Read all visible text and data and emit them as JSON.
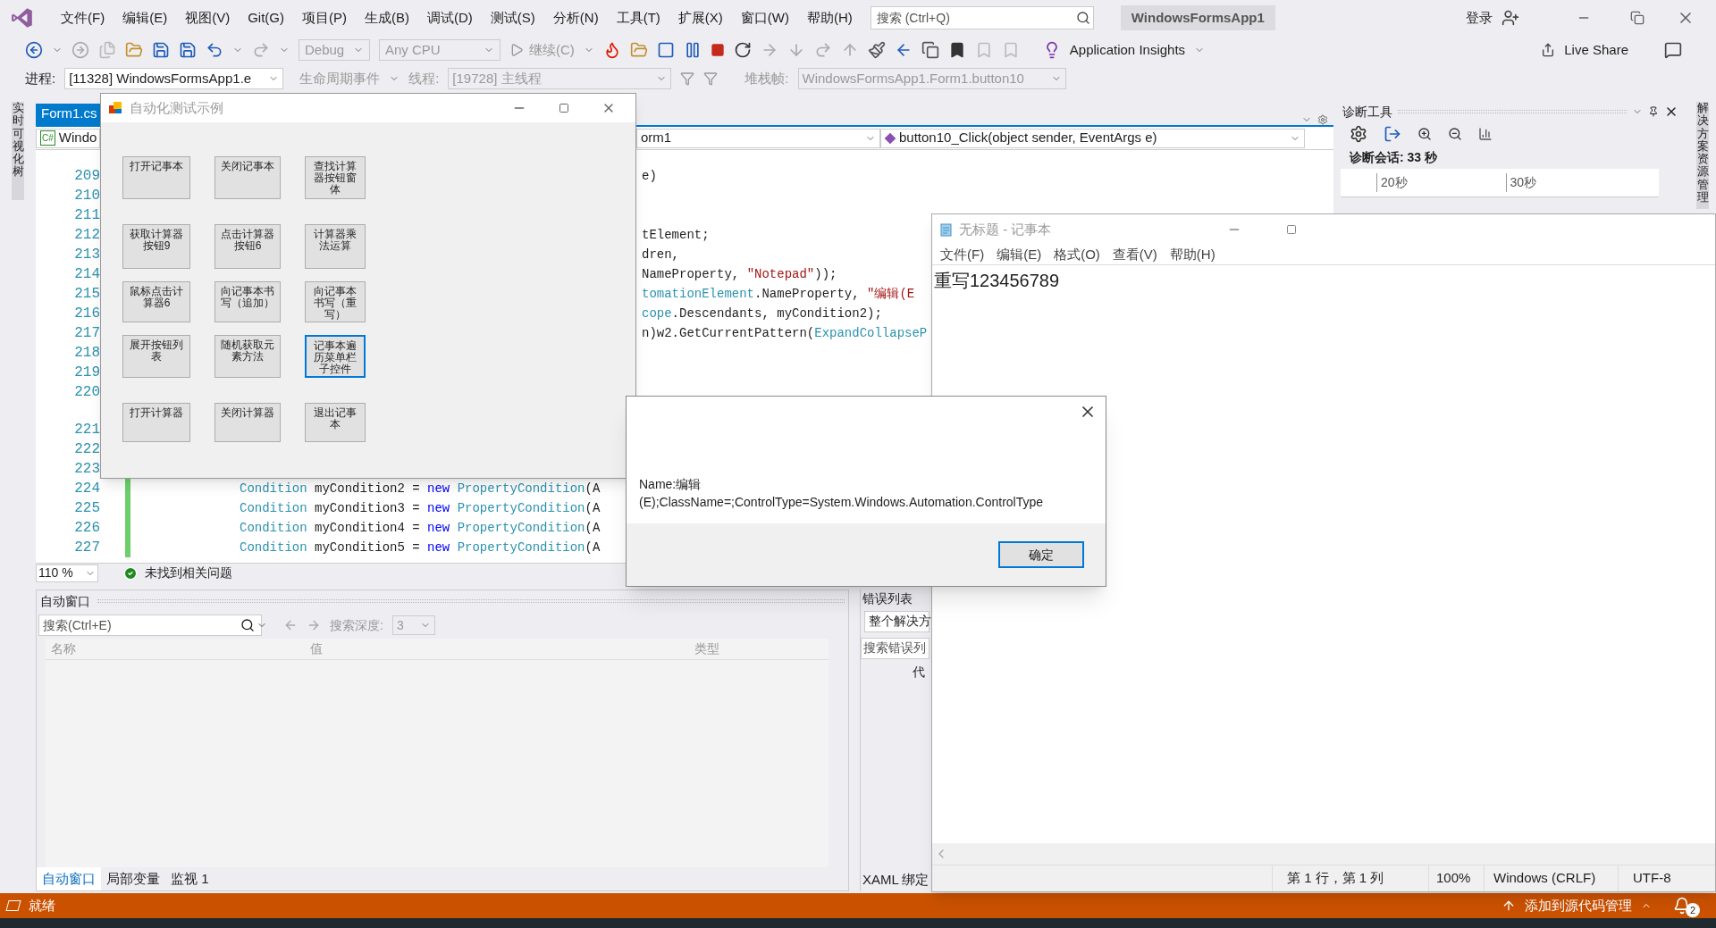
{
  "menu_bar": {
    "items": [
      "文件(F)",
      "编辑(E)",
      "视图(V)",
      "Git(G)",
      "项目(P)",
      "生成(B)",
      "调试(D)",
      "测试(S)",
      "分析(N)",
      "工具(T)",
      "扩展(X)",
      "窗口(W)",
      "帮助(H)"
    ],
    "search": {
      "placeholder": "搜索 (Ctrl+Q)"
    },
    "solution_name": "WindowsFormsApp1",
    "sign_in": "登录"
  },
  "toolbar": {
    "configuration": "Debug",
    "platform": "Any CPU",
    "continue": "继续(C)",
    "insights": "Application Insights",
    "live_share": "Live Share"
  },
  "debug_location": {
    "process_label": "进程:",
    "process": "[11328] WindowsFormsApp1.e",
    "lifecycle": "生命周期事件",
    "thread_label": "线程:",
    "thread": "[19728] 主线程",
    "stack_label": "堆栈帧:",
    "stack_frame": "WindowsFormsApp1.Form1.button10"
  },
  "left_tab": "实时可视化树",
  "right_tab": "解决方案资源管理",
  "editor": {
    "tabs": [
      {
        "label": "Form1.cs",
        "selected": true
      }
    ],
    "language_badge": "C#",
    "nav": [
      "Windo",
      "orm1",
      "button10_Click(object sender, EventArgs e)"
    ],
    "lines": [
      {
        "number": "209",
        "kind": "fragment",
        "tokens": [
          {
            "text": "e)",
            "kind": "plain"
          }
        ]
      },
      {
        "number": "210",
        "kind": "fragment"
      },
      {
        "number": "211",
        "kind": "fragment"
      },
      {
        "number": "212",
        "kind": "fragment",
        "tokens": [
          {
            "text": "tElement;",
            "kind": "plain"
          }
        ]
      },
      {
        "number": "213",
        "kind": "fragment",
        "tokens": [
          {
            "text": "dren,",
            "kind": "plain"
          }
        ]
      },
      {
        "number": "214",
        "kind": "fragment",
        "tokens": [
          {
            "text": "NameProperty, ",
            "kind": "plain"
          },
          {
            "text": "\"Notepad\"",
            "kind": "string"
          },
          {
            "text": "));",
            "kind": "plain"
          }
        ]
      },
      {
        "number": "215",
        "kind": "fragment",
        "tokens": [
          {
            "text": "tomationElement",
            "kind": "type"
          },
          {
            "text": ".NameProperty, ",
            "kind": "plain"
          },
          {
            "text": "\"编辑(E",
            "kind": "string"
          }
        ]
      },
      {
        "number": "216",
        "kind": "fragment",
        "tokens": [
          {
            "text": "cope",
            "kind": "type"
          },
          {
            "text": ".Descendants, myCondition2);",
            "kind": "plain"
          }
        ]
      },
      {
        "number": "217",
        "kind": "fragment",
        "tokens": [
          {
            "text": "n)w2.GetCurrentPattern(",
            "kind": "plain"
          },
          {
            "text": "ExpandCollapseP",
            "kind": "type"
          }
        ]
      },
      {
        "number": "218",
        "kind": "fragment"
      },
      {
        "number": "219",
        "kind": "fragment"
      },
      {
        "number": "220",
        "kind": "fragment"
      },
      {
        "number": "221",
        "kind": "full"
      },
      {
        "number": "222",
        "kind": "full"
      },
      {
        "number": "223",
        "kind": "full"
      },
      {
        "number": "224",
        "kind": "full",
        "tokens": [
          {
            "text": "Condition",
            "kind": "type"
          },
          {
            "text": " myCondition2 = ",
            "kind": "plain"
          },
          {
            "text": "new",
            "kind": "keyword"
          },
          {
            "text": " PropertyCondition",
            "kind": "type"
          },
          {
            "text": "(A",
            "kind": "plain"
          }
        ]
      },
      {
        "number": "225",
        "kind": "full",
        "tokens": [
          {
            "text": "Condition",
            "kind": "type"
          },
          {
            "text": " myCondition3 = ",
            "kind": "plain"
          },
          {
            "text": "new",
            "kind": "keyword"
          },
          {
            "text": " PropertyCondition",
            "kind": "type"
          },
          {
            "text": "(A",
            "kind": "plain"
          }
        ]
      },
      {
        "number": "226",
        "kind": "full",
        "tokens": [
          {
            "text": "Condition",
            "kind": "type"
          },
          {
            "text": " myCondition4 = ",
            "kind": "plain"
          },
          {
            "text": "new",
            "kind": "keyword"
          },
          {
            "text": " PropertyCondition",
            "kind": "type"
          },
          {
            "text": "(A",
            "kind": "plain"
          }
        ]
      },
      {
        "number": "227",
        "kind": "full",
        "tokens": [
          {
            "text": "Condition",
            "kind": "type"
          },
          {
            "text": " myCondition5 = ",
            "kind": "plain"
          },
          {
            "text": "new",
            "kind": "keyword"
          },
          {
            "text": " PropertyCondition",
            "kind": "type"
          },
          {
            "text": "(A",
            "kind": "plain"
          }
        ]
      }
    ],
    "zoom": "110 %",
    "issues": "未找到相关问题"
  },
  "diagnostics": {
    "title": "诊断工具",
    "session": "诊断会话: 33 秒",
    "ticks": [
      "20秒",
      "30秒"
    ]
  },
  "autos": {
    "title": "自动窗口",
    "search": {
      "placeholder": "搜索(Ctrl+E)"
    },
    "depth_label": "搜索深度:",
    "depth": "3",
    "columns": [
      "名称",
      "值",
      "类型"
    ],
    "tabs": [
      {
        "label": "自动窗口",
        "selected": true
      },
      {
        "label": "局部变量",
        "selected": false
      },
      {
        "label": "监视 1",
        "selected": false
      }
    ]
  },
  "error_list": {
    "title": "错误列表",
    "scope": "整个解决方",
    "search": {
      "placeholder": "搜索错误列"
    },
    "column": "代",
    "tab": "XAML 绑定"
  },
  "form_window": {
    "title": "自动化测试示例",
    "buttons": [
      {
        "label": "打开记事本",
        "focused": false
      },
      {
        "label": "关闭记事本",
        "focused": false
      },
      {
        "label": "查找计算器按钮窗体",
        "focused": false
      },
      {
        "label": "获取计算器按钮9",
        "focused": false
      },
      {
        "label": "点击计算器按钮6",
        "focused": false
      },
      {
        "label": "计算器乘法运算",
        "focused": false
      },
      {
        "label": "鼠标点击计算器6",
        "focused": false
      },
      {
        "label": "向记事本书写（追加）",
        "focused": false
      },
      {
        "label": "向记事本书写（重写）",
        "focused": false
      },
      {
        "label": "展开按钮列表",
        "focused": false
      },
      {
        "label": "随机获取元素方法",
        "focused": false
      },
      {
        "label": "记事本遍历菜单栏子控件",
        "focused": true
      },
      {
        "label": "打开计算器",
        "focused": false
      },
      {
        "label": "关闭计算器",
        "focused": false
      },
      {
        "label": "退出记事本",
        "focused": false
      }
    ]
  },
  "notepad": {
    "title": "无标题 - 记事本",
    "menu": [
      "文件(F)",
      "编辑(E)",
      "格式(O)",
      "查看(V)",
      "帮助(H)"
    ],
    "text": "重写123456789",
    "status": [
      "第 1 行，第 1 列",
      "100%",
      "Windows (CRLF)",
      "UTF-8"
    ]
  },
  "message_box": {
    "text": "Name:编辑(E);ClassName=;ControlType=System.Windows.Automation.ControlType",
    "button": "确定"
  },
  "status_bar": {
    "state": "就绪",
    "source_control": "添加到源代码管理",
    "notifications": "2"
  }
}
